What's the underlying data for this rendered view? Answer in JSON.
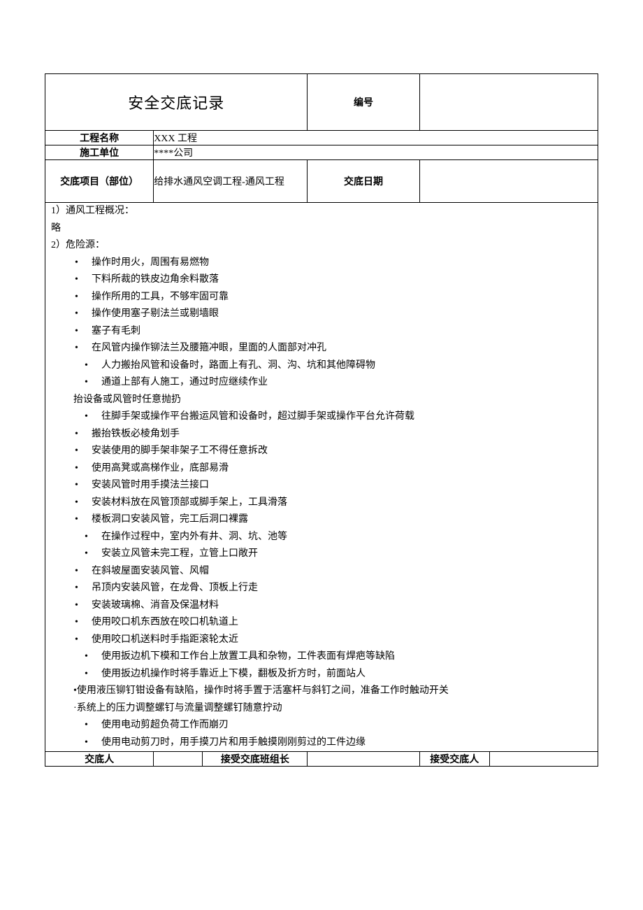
{
  "header": {
    "title": "安全交底记录",
    "code_label": "编号",
    "code_value": "",
    "project_label": "工程名称",
    "project_value": "XXX 工程",
    "unit_label": "施工单位",
    "unit_value": "****公司",
    "item_label": "交底项目（部位）",
    "item_value": "给排水通风空调工程-通风工程",
    "date_label": "交底日期",
    "date_value": ""
  },
  "body": {
    "line1": "1）通风工程概况：",
    "line1b": "略",
    "line2": "2）危险源：",
    "items_a": [
      "操作时用火，周围有易燃物",
      "下料所裁的铁皮边角余料散落",
      "操作所用的工具，不够牢固可靠",
      "操作使用塞子剔法兰或剔墙眼",
      "塞子有毛刺",
      "在风管内操作铆法兰及腰箍冲眼，里面的人面部对冲孔",
      "人力搬抬风管和设备时，路面上有孔、洞、沟、坑和其他障碍物",
      "通道上部有人施工，通过时应继续作业"
    ],
    "inset1": "抬设备或风管时任意抛扔",
    "items_b": [
      "往脚手架或操作平台搬运风管和设备时，超过脚手架或操作平台允许荷载",
      "搬抬铁板必棱角划手",
      "安装使用的脚手架非架子工不得任意拆改",
      "使用高凳或高梯作业，底部易滑",
      "安装风管时用手摸法兰接口",
      "安装材料放在风管顶部或脚手架上，工具滑落",
      "楼板洞口安装风管，完工后洞口裸露",
      "在操作过程中，室内外有井、洞、坑、池等",
      "安装立风管未完工程，立管上口敞开",
      "在斜坡屋面安装风管、风帽",
      "吊顶内安装风管，在龙骨、顶板上行走",
      "安装玻璃棉、消音及保温材料",
      "使用咬口机东西放在咬口机轨道上",
      "使用咬口机送料时手指距滚轮太近",
      "使用扳边机下模和工作台上放置工具和杂物，工件表面有焊疤等缺陷",
      "使用扳边机操作时将手靠近上下模，翻板及折方时，前面站人"
    ],
    "inset2": "•使用液压铆钉钳设备有缺陷，操作时将手置于活塞杆与斜钉之间，准备工作时触动开关",
    "inset3": "·系统上的压力调整螺钉与流量调整螺钉随意拧动",
    "items_c": [
      "使用电动剪超负荷工作而崩刃",
      "使用电动剪刀时，用手摸刀片和用手触摸刚刚剪过的工件边缘"
    ]
  },
  "footer": {
    "sender_label": "交底人",
    "sender_value": "",
    "leader_label": "接受交底班组长",
    "leader_value": "",
    "receiver_label": "接受交底人",
    "receiver_value": ""
  }
}
